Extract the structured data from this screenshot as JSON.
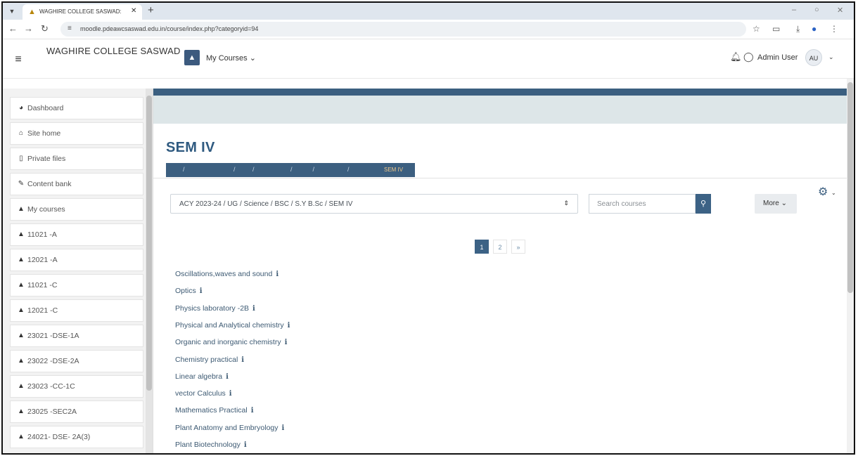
{
  "browser": {
    "tab_title": "WAGHIRE COLLEGE SASWAD: :",
    "new_tab": "+",
    "url": "moodle.pdeawcsaswad.edu.in/course/index.php?categoryid=94"
  },
  "header": {
    "brand": "WAGHIRE COLLEGE SASWAD",
    "my_courses": "My Courses",
    "user_name": "Admin User",
    "user_initials": "AU"
  },
  "sidebar": {
    "items": [
      {
        "label": "Dashboard",
        "icon": "dashboard-icon"
      },
      {
        "label": "Site home",
        "icon": "home-icon"
      },
      {
        "label": "Private files",
        "icon": "file-icon"
      },
      {
        "label": "Content bank",
        "icon": "paint-brush-icon"
      },
      {
        "label": "My courses",
        "icon": "graduation-cap-icon"
      },
      {
        "label": "11021 -A",
        "icon": "graduation-cap-icon"
      },
      {
        "label": "12021 -A",
        "icon": "graduation-cap-icon"
      },
      {
        "label": "11021 -C",
        "icon": "graduation-cap-icon"
      },
      {
        "label": "12021 -C",
        "icon": "graduation-cap-icon"
      },
      {
        "label": "23021 -DSE-1A",
        "icon": "graduation-cap-icon"
      },
      {
        "label": "23022 -DSE-2A",
        "icon": "graduation-cap-icon"
      },
      {
        "label": "23023 -CC-1C",
        "icon": "graduation-cap-icon"
      },
      {
        "label": "23025 -SEC2A",
        "icon": "graduation-cap-icon"
      },
      {
        "label": "24021- DSE- 2A(3)",
        "icon": "graduation-cap-icon"
      }
    ]
  },
  "main": {
    "heading": "SEM IV",
    "breadcrumb_current": "SEM IV",
    "category_select": "ACY 2023-24 / UG / Science / BSC / S.Y B.Sc / SEM IV",
    "search_placeholder": "Search courses",
    "more_label": "More",
    "pagination": [
      "1",
      "2",
      "»"
    ],
    "courses": [
      "Oscillations,waves and sound",
      "Optics",
      "Physics laboratory -2B",
      "Physical and Analytical chemistry",
      "Organic and inorganic chemistry",
      "Chemistry practical",
      "Linear algebra",
      "vector Calculus",
      "Mathematics Practical",
      "Plant Anatomy and Embryology",
      "Plant Biotechnology"
    ]
  },
  "colors": {
    "primary": "#3c6285",
    "heading": "#2f5a80",
    "topband": "#3b5f80"
  }
}
